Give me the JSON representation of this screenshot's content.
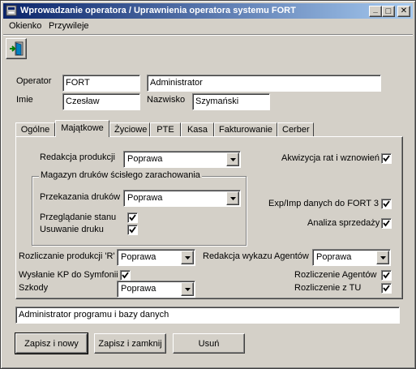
{
  "window": {
    "title": "Wprowadzanie operatora / Uprawnienia operatora systemu FORT",
    "minimize_glyph": "_",
    "maximize_glyph": "□",
    "close_glyph": "✕"
  },
  "menu": {
    "items": [
      {
        "label": "Okienko"
      },
      {
        "label": "Przywileje"
      }
    ]
  },
  "toolbar": {
    "exit_icon": "exit-door-icon"
  },
  "form": {
    "operator_label": "Operator",
    "operator_value": "FORT",
    "operator_desc_value": "Administrator",
    "imie_label": "Imie",
    "imie_value": "Czesław",
    "nazwisko_label": "Nazwisko",
    "nazwisko_value": "Szymański"
  },
  "tabs": [
    {
      "label": "Ogólne"
    },
    {
      "label": "Majątkowe",
      "active": true
    },
    {
      "label": "Życiowe"
    },
    {
      "label": "PTE"
    },
    {
      "label": "Kasa"
    },
    {
      "label": "Fakturowanie"
    },
    {
      "label": "Cerber"
    }
  ],
  "panel": {
    "redakcja_produkcji_label": "Redakcja produkcji",
    "redakcja_produkcji_value": "Poprawa",
    "akwizycja_label": "Akwizycja rat i wznowień",
    "akwizycja_checked": true,
    "magazyn_legend": "Magazyn druków ścisłego zarachowania",
    "przekazania_label": "Przekazania druków",
    "przekazania_value": "Poprawa",
    "przegladanie_label": "Przeglądanie stanu",
    "przegladanie_checked": true,
    "usuwanie_label": "Usuwanie druku",
    "usuwanie_checked": true,
    "exp_imp_label": "Exp/Imp danych do FORT 3",
    "exp_imp_checked": true,
    "analiza_label": "Analiza sprzedaży",
    "analiza_checked": true,
    "rozliczanie_r_label": "Rozliczanie produkcji 'R'",
    "rozliczanie_r_value": "Poprawa",
    "redakcja_wykazu_label": "Redakcja wykazu Agentów",
    "redakcja_wykazu_value": "Poprawa",
    "wyslanie_kp_label": "Wysłanie KP do Symfonii",
    "wyslanie_kp_checked": true,
    "rozliczenie_agentow_label": "Rozliczenie Agentów",
    "rozliczenie_agentow_checked": true,
    "szkody_label": "Szkody",
    "szkody_value": "Poprawa",
    "rozliczenie_tu_label": "Rozliczenie z TU",
    "rozliczenie_tu_checked": true
  },
  "description_value": "Administrator programu i bazy danych",
  "buttons": {
    "zapisz_nowy": "Zapisz i nowy",
    "zapisz_zamknij": "Zapisz i zamknij",
    "usun": "Usuń"
  },
  "colors": {
    "titlebar_start": "#0a246a",
    "titlebar_end": "#a6caf0",
    "face": "#d4d0c8"
  }
}
